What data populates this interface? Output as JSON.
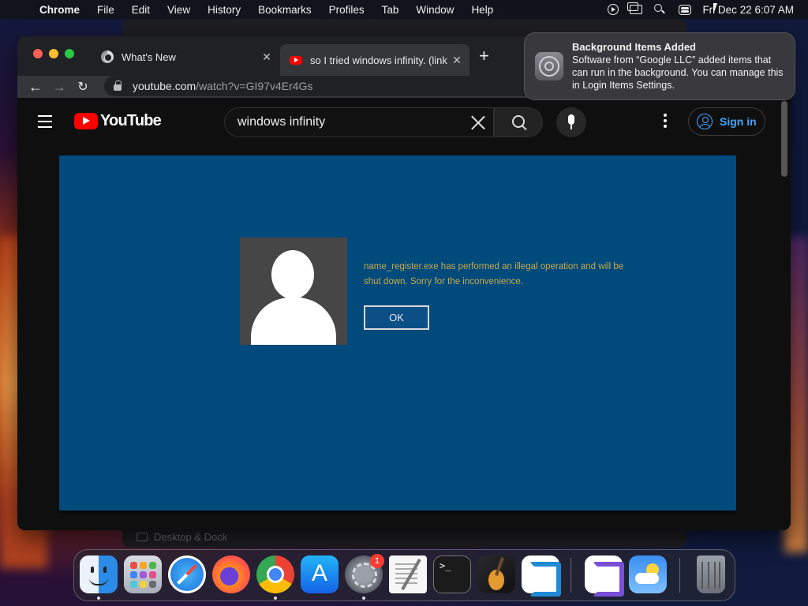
{
  "menubar": {
    "app_name": "Chrome",
    "items": [
      "File",
      "Edit",
      "View",
      "History",
      "Bookmarks",
      "Profiles",
      "Tab",
      "Window",
      "Help"
    ],
    "clock": "Fri Dec 22  6:07 AM"
  },
  "background_window": {
    "label": "Desktop & Dock"
  },
  "browser": {
    "tabs": [
      {
        "title": "What's New",
        "icon": "chrome-icon"
      },
      {
        "title": "so I tried windows infinity. (link",
        "icon": "youtube-icon",
        "active": true
      }
    ],
    "url_host": "youtube.com",
    "url_path": "/watch?v=GI97v4Er4Gs"
  },
  "youtube": {
    "logo_text": "YouTube",
    "search_value": "windows infinity",
    "signin_label": "Sign in"
  },
  "video": {
    "error_text": "name_register.exe has performed an illegal operation and will be shut down. Sorry for the inconvenience.",
    "ok_label": "OK",
    "background_color": "#004a7c"
  },
  "notification": {
    "title": "Background Items Added",
    "body": "Software from “Google LLC” added items that can run in the background. You can manage this in Login Items Settings."
  },
  "dock": {
    "settings_badge": "1",
    "apps": [
      "Finder",
      "Launchpad",
      "Safari",
      "Firefox",
      "Google Chrome",
      "App Store",
      "System Settings",
      "TextEdit",
      "Terminal",
      "GarageBand",
      "Visual Studio Code",
      "Visual Studio",
      "Weather",
      "Trash"
    ]
  }
}
